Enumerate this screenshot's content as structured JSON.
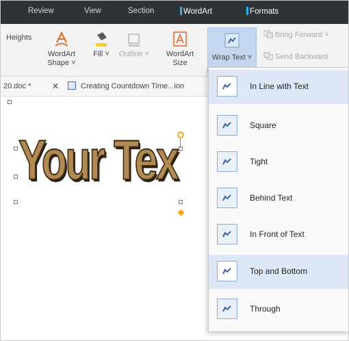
{
  "tabs": {
    "review": "Review",
    "view": "View",
    "section": "Section",
    "wordart": "WordArt",
    "formats": "Formats"
  },
  "ribbon": {
    "heights": "Heights",
    "wordart_shape": [
      "WordArt",
      "Shape ˅"
    ],
    "fill": "Fill ˅",
    "outline": "Outline ˅",
    "wordart_size": [
      "WordArt",
      "Size"
    ],
    "wrap_text": "Wrap Text ˅",
    "bring_forward": "Bring Forward ˅",
    "send_backward": "Send Backward"
  },
  "doc_tabs": {
    "tab1": "20.doc *",
    "close": "✕",
    "tab2": "Creating Countdown Time...ion"
  },
  "document": {
    "wordart_text": "Your Tex"
  },
  "wrap_menu": {
    "items": [
      {
        "label": "In Line with Text",
        "selected": true
      },
      {
        "label": "Square",
        "selected": false
      },
      {
        "label": "Tight",
        "selected": false
      },
      {
        "label": "Behind Text",
        "selected": false
      },
      {
        "label": "In Front of Text",
        "selected": false
      },
      {
        "label": "Top and Bottom",
        "selected": true
      },
      {
        "label": "Through",
        "selected": false
      }
    ]
  },
  "colors": {
    "tab_bar": "#2f3237",
    "context_marker": "#2bb3e8",
    "highlight": "#dde7f5",
    "wordart_fill": "#b08a52",
    "handle_accent": "#f5a623"
  }
}
